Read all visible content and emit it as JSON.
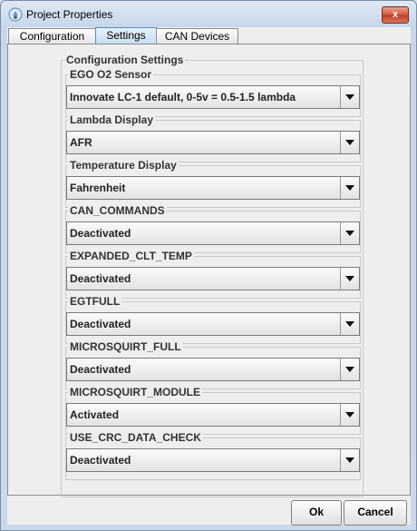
{
  "window": {
    "title": "Project Properties",
    "close_symbol": "x"
  },
  "tabs": [
    {
      "label": "Configuration",
      "active": false
    },
    {
      "label": "Settings",
      "active": true
    },
    {
      "label": "CAN Devices",
      "active": false
    }
  ],
  "settings": {
    "group_title": "Configuration Settings",
    "fields": [
      {
        "label": "EGO O2 Sensor",
        "value": "Innovate LC-1 default, 0-5v = 0.5-1.5 lambda"
      },
      {
        "label": "Lambda Display",
        "value": "AFR"
      },
      {
        "label": "Temperature Display",
        "value": "Fahrenheit"
      },
      {
        "label": "CAN_COMMANDS",
        "value": "Deactivated"
      },
      {
        "label": "EXPANDED_CLT_TEMP",
        "value": "Deactivated"
      },
      {
        "label": "EGTFULL",
        "value": "Deactivated"
      },
      {
        "label": "MICROSQUIRT_FULL",
        "value": "Deactivated"
      },
      {
        "label": "MICROSQUIRT_MODULE",
        "value": "Activated"
      },
      {
        "label": "USE_CRC_DATA_CHECK",
        "value": "Deactivated"
      }
    ]
  },
  "buttons": {
    "ok": "Ok",
    "cancel": "Cancel"
  },
  "icons": {
    "app": "project-icon",
    "close": "close-icon",
    "dropdown": "chevron-down-icon"
  }
}
